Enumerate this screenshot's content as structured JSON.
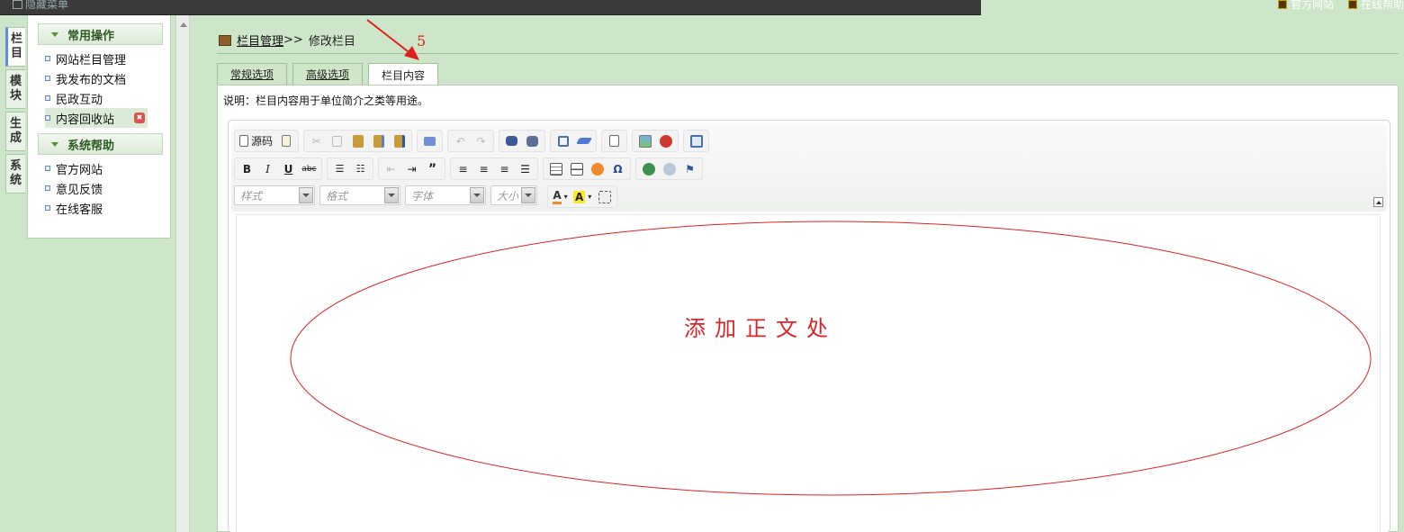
{
  "topbar": {
    "hide_menu": "隐藏菜单",
    "links": [
      "官方网站",
      "在线帮助"
    ]
  },
  "vtabs": [
    {
      "chars": [
        "栏",
        "目"
      ],
      "active": true
    },
    {
      "chars": [
        "模",
        "块"
      ],
      "active": false
    },
    {
      "chars": [
        "生",
        "成"
      ],
      "active": false
    },
    {
      "chars": [
        "系",
        "统"
      ],
      "active": false
    }
  ],
  "menu": {
    "common": {
      "title": "常用操作",
      "items": [
        "网站栏目管理",
        "我发布的文档",
        "民政互动",
        "内容回收站"
      ]
    },
    "help": {
      "title": "系统帮助",
      "items": [
        "官方网站",
        "意见反馈",
        "在线客服"
      ]
    }
  },
  "breadcrumb": {
    "link": "栏目管理",
    "sep": ">>",
    "current": "修改栏目"
  },
  "tabs": [
    "常规选项",
    "高级选项",
    "栏目内容"
  ],
  "active_tab": "栏目内容",
  "description": "说明：栏目内容用于单位简介之类等用途。",
  "editor": {
    "source_label": "源码",
    "combos": [
      "样式",
      "格式",
      "字体",
      "大小"
    ]
  },
  "annotations": {
    "step_number": "5",
    "body_hint": "添加正文处",
    "color": "#e02020"
  }
}
